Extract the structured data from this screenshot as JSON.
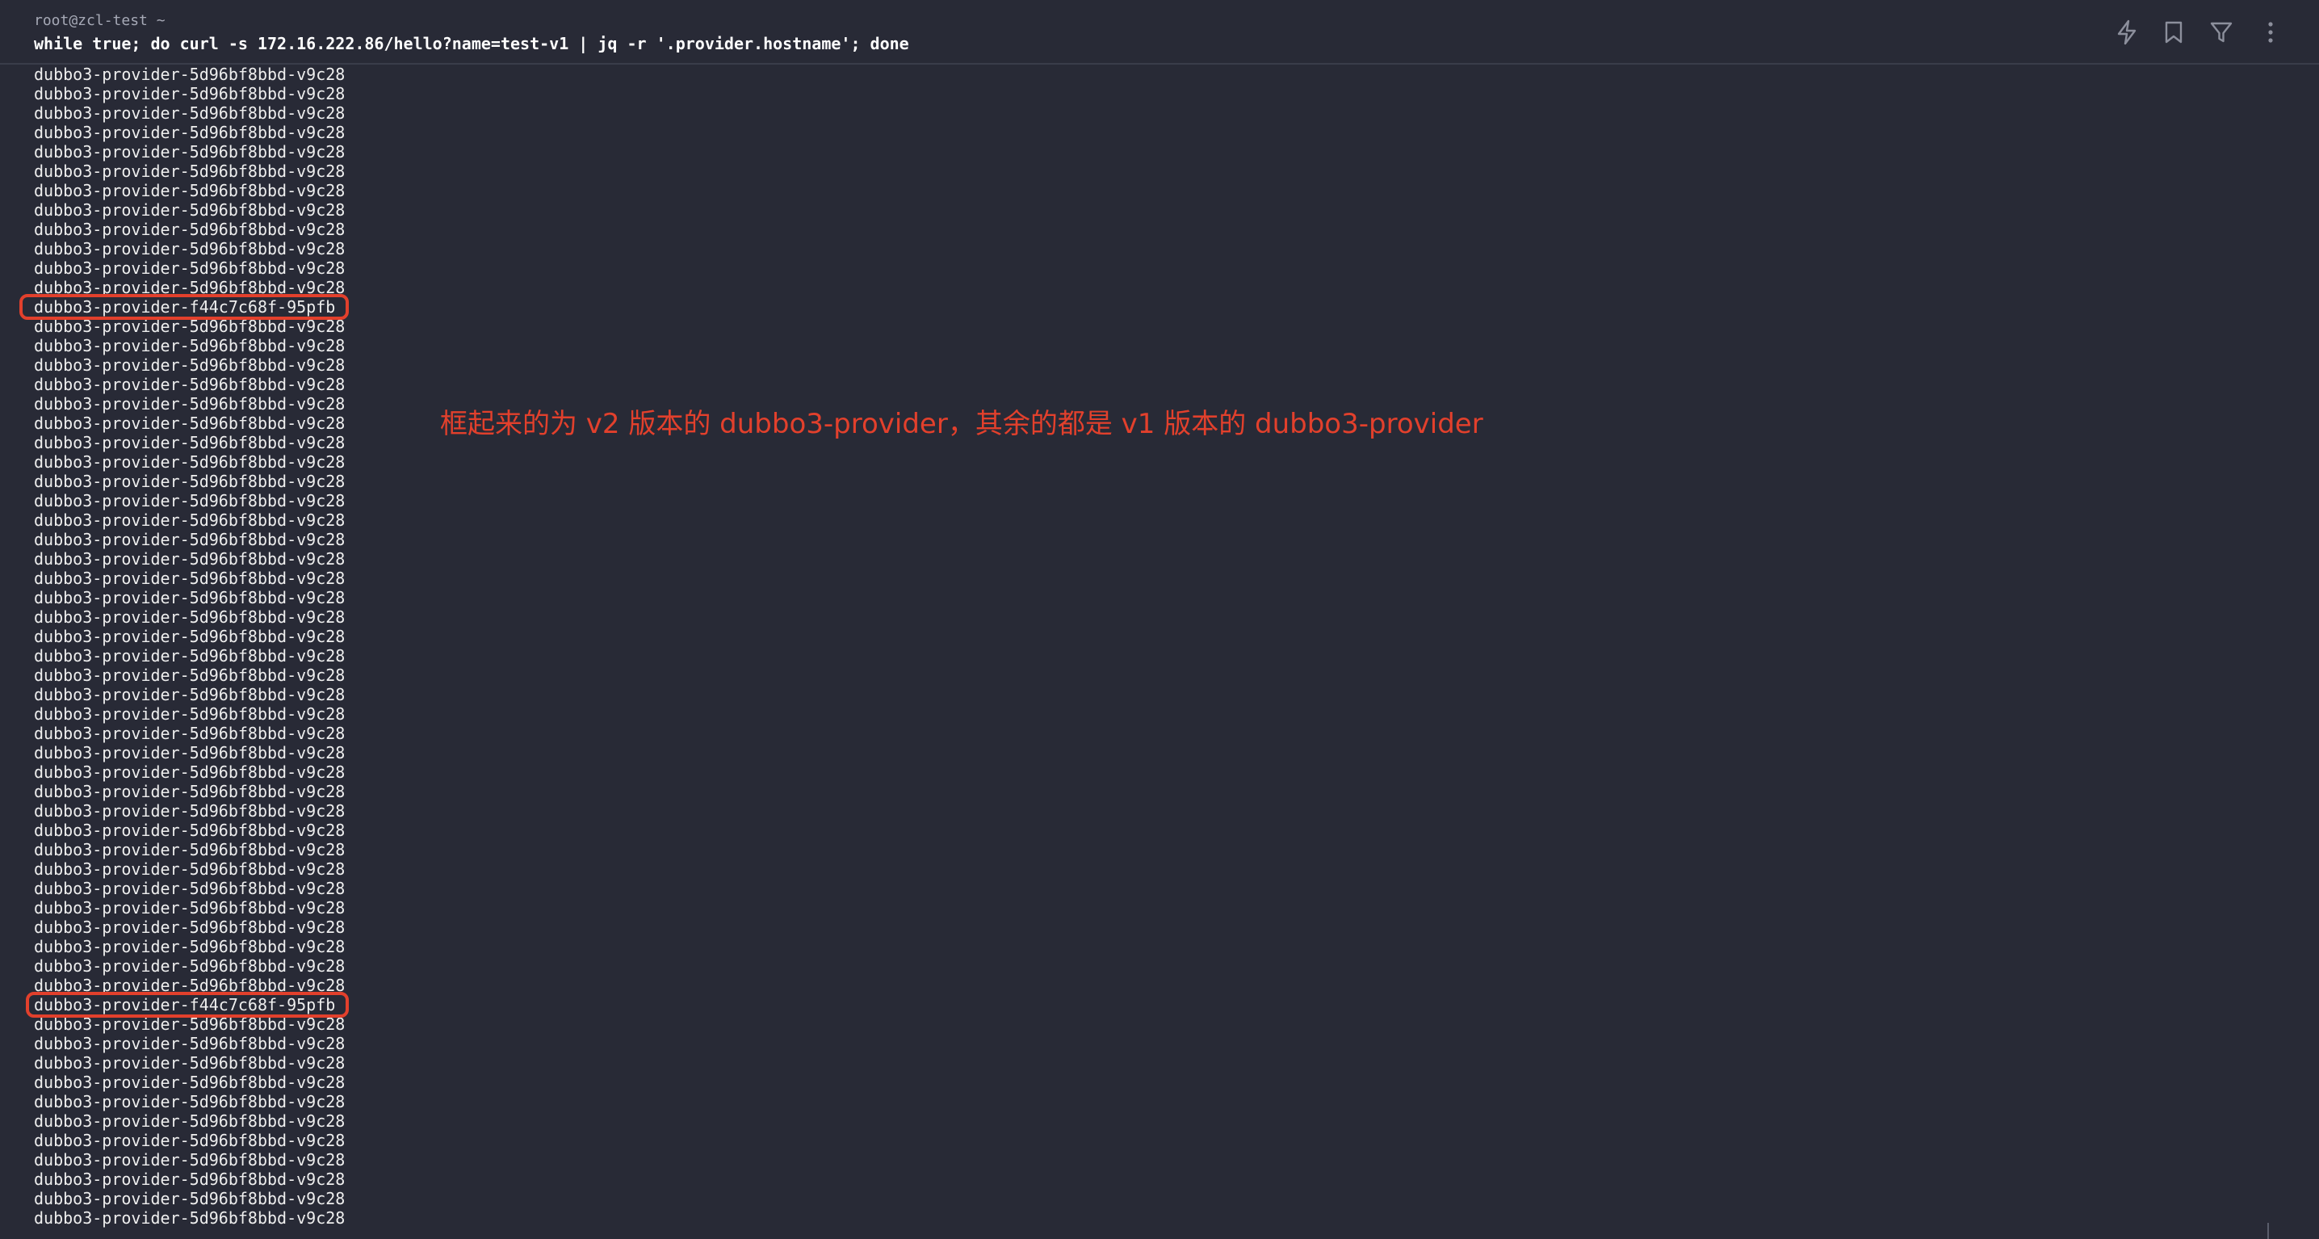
{
  "terminal": {
    "prompt": "root@zcl-test ~",
    "command": "while true; do curl -s 172.16.222.86/hello?name=test-v1 | jq -r '.provider.hostname'; done",
    "output_lines": [
      "dubbo3-provider-5d96bf8bbd-v9c28",
      "dubbo3-provider-5d96bf8bbd-v9c28",
      "dubbo3-provider-5d96bf8bbd-v9c28",
      "dubbo3-provider-5d96bf8bbd-v9c28",
      "dubbo3-provider-5d96bf8bbd-v9c28",
      "dubbo3-provider-5d96bf8bbd-v9c28",
      "dubbo3-provider-5d96bf8bbd-v9c28",
      "dubbo3-provider-5d96bf8bbd-v9c28",
      "dubbo3-provider-5d96bf8bbd-v9c28",
      "dubbo3-provider-5d96bf8bbd-v9c28",
      "dubbo3-provider-5d96bf8bbd-v9c28",
      "dubbo3-provider-5d96bf8bbd-v9c28",
      "dubbo3-provider-f44c7c68f-95pfb",
      "dubbo3-provider-5d96bf8bbd-v9c28",
      "dubbo3-provider-5d96bf8bbd-v9c28",
      "dubbo3-provider-5d96bf8bbd-v9c28",
      "dubbo3-provider-5d96bf8bbd-v9c28",
      "dubbo3-provider-5d96bf8bbd-v9c28",
      "dubbo3-provider-5d96bf8bbd-v9c28",
      "dubbo3-provider-5d96bf8bbd-v9c28",
      "dubbo3-provider-5d96bf8bbd-v9c28",
      "dubbo3-provider-5d96bf8bbd-v9c28",
      "dubbo3-provider-5d96bf8bbd-v9c28",
      "dubbo3-provider-5d96bf8bbd-v9c28",
      "dubbo3-provider-5d96bf8bbd-v9c28",
      "dubbo3-provider-5d96bf8bbd-v9c28",
      "dubbo3-provider-5d96bf8bbd-v9c28",
      "dubbo3-provider-5d96bf8bbd-v9c28",
      "dubbo3-provider-5d96bf8bbd-v9c28",
      "dubbo3-provider-5d96bf8bbd-v9c28",
      "dubbo3-provider-5d96bf8bbd-v9c28",
      "dubbo3-provider-5d96bf8bbd-v9c28",
      "dubbo3-provider-5d96bf8bbd-v9c28",
      "dubbo3-provider-5d96bf8bbd-v9c28",
      "dubbo3-provider-5d96bf8bbd-v9c28",
      "dubbo3-provider-5d96bf8bbd-v9c28",
      "dubbo3-provider-5d96bf8bbd-v9c28",
      "dubbo3-provider-5d96bf8bbd-v9c28",
      "dubbo3-provider-5d96bf8bbd-v9c28",
      "dubbo3-provider-5d96bf8bbd-v9c28",
      "dubbo3-provider-5d96bf8bbd-v9c28",
      "dubbo3-provider-5d96bf8bbd-v9c28",
      "dubbo3-provider-5d96bf8bbd-v9c28",
      "dubbo3-provider-5d96bf8bbd-v9c28",
      "dubbo3-provider-5d96bf8bbd-v9c28",
      "dubbo3-provider-5d96bf8bbd-v9c28",
      "dubbo3-provider-5d96bf8bbd-v9c28",
      "dubbo3-provider-5d96bf8bbd-v9c28",
      "dubbo3-provider-f44c7c68f-95pfb",
      "dubbo3-provider-5d96bf8bbd-v9c28",
      "dubbo3-provider-5d96bf8bbd-v9c28",
      "dubbo3-provider-5d96bf8bbd-v9c28",
      "dubbo3-provider-5d96bf8bbd-v9c28",
      "dubbo3-provider-5d96bf8bbd-v9c28",
      "dubbo3-provider-5d96bf8bbd-v9c28",
      "dubbo3-provider-5d96bf8bbd-v9c28",
      "dubbo3-provider-5d96bf8bbd-v9c28",
      "dubbo3-provider-5d96bf8bbd-v9c28",
      "dubbo3-provider-5d96bf8bbd-v9c28",
      "dubbo3-provider-5d96bf8bbd-v9c28"
    ],
    "highlighted_lines": [
      12,
      48
    ]
  },
  "annotation": {
    "text": "框起来的为 v2 版本的 dubbo3-provider，其余的都是 v1 版本的 dubbo3-provider"
  },
  "toolbar": {
    "icons": [
      "lightning-icon",
      "bookmark-icon",
      "filter-icon",
      "more-vertical-icon"
    ]
  },
  "colors": {
    "background": "#282a36",
    "text": "#eeeeee",
    "highlight": "#e2402c",
    "icon": "#8c8f9c"
  }
}
